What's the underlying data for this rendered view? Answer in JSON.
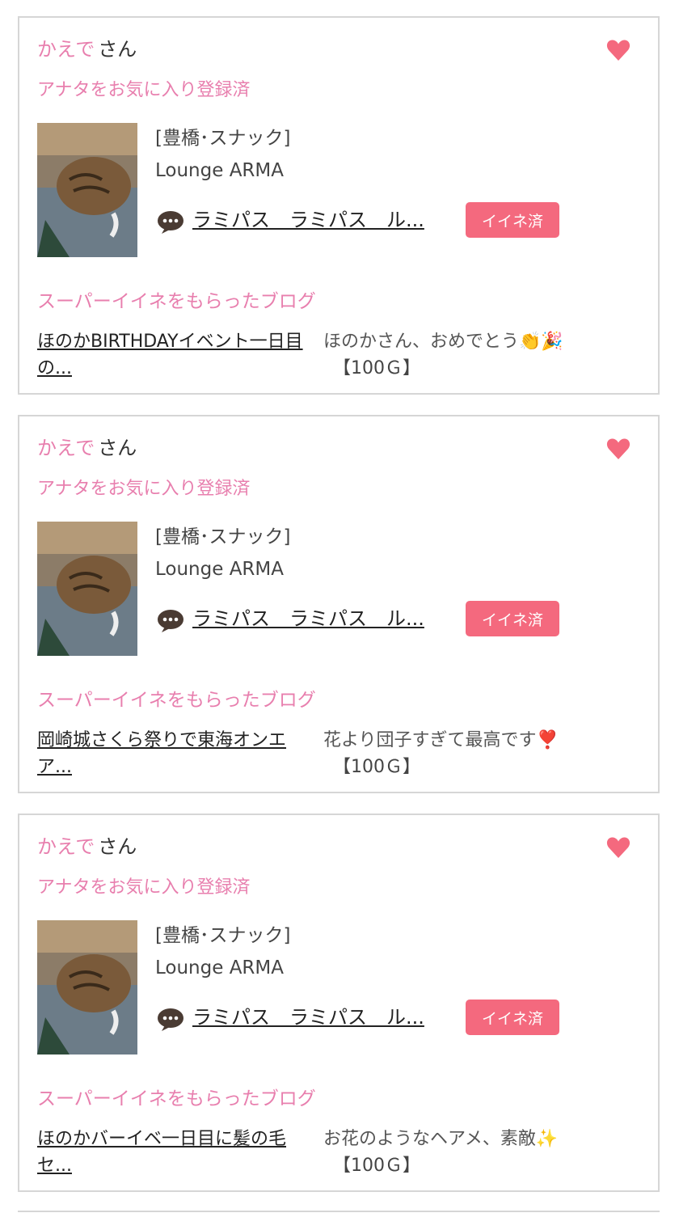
{
  "cards": [
    {
      "name": "かえで",
      "san": "さん",
      "favorite_status": "アナタをお気に入り登録済",
      "area": "[豊橋･スナック]",
      "shop": "Lounge ARMA",
      "comment": "ラミパス　ラミパス　ル...",
      "like_button": "イイネ済",
      "blog_heading": "スーパーイイネをもらったブログ",
      "blog_title": "ほのかBIRTHDAYイベント一日目の...",
      "blog_comment": "ほのかさん、おめでとう👏🎉",
      "points": "【100Ｇ】"
    },
    {
      "name": "かえで",
      "san": "さん",
      "favorite_status": "アナタをお気に入り登録済",
      "area": "[豊橋･スナック]",
      "shop": "Lounge ARMA",
      "comment": "ラミパス　ラミパス　ル...",
      "like_button": "イイネ済",
      "blog_heading": "スーパーイイネをもらったブログ",
      "blog_title": "岡崎城さくら祭りで東海オンエア...",
      "blog_comment": "花より団子すぎて最高です❣️",
      "points": "【100Ｇ】"
    },
    {
      "name": "かえで",
      "san": "さん",
      "favorite_status": "アナタをお気に入り登録済",
      "area": "[豊橋･スナック]",
      "shop": "Lounge ARMA",
      "comment": "ラミパス　ラミパス　ル...",
      "like_button": "イイネ済",
      "blog_heading": "スーパーイイネをもらったブログ",
      "blog_title": "ほのかバーイベ一日目に髪の毛セ...",
      "blog_comment": "お花のようなヘアメ、素敵✨",
      "points": "【100Ｇ】"
    }
  ],
  "colors": {
    "accent_pink": "#e87fae",
    "button_pink": "#f4697e",
    "heart_pink": "#f4697e",
    "border": "#d6d6d6"
  },
  "icons": [
    "heart-icon",
    "comment-bubble-icon"
  ]
}
